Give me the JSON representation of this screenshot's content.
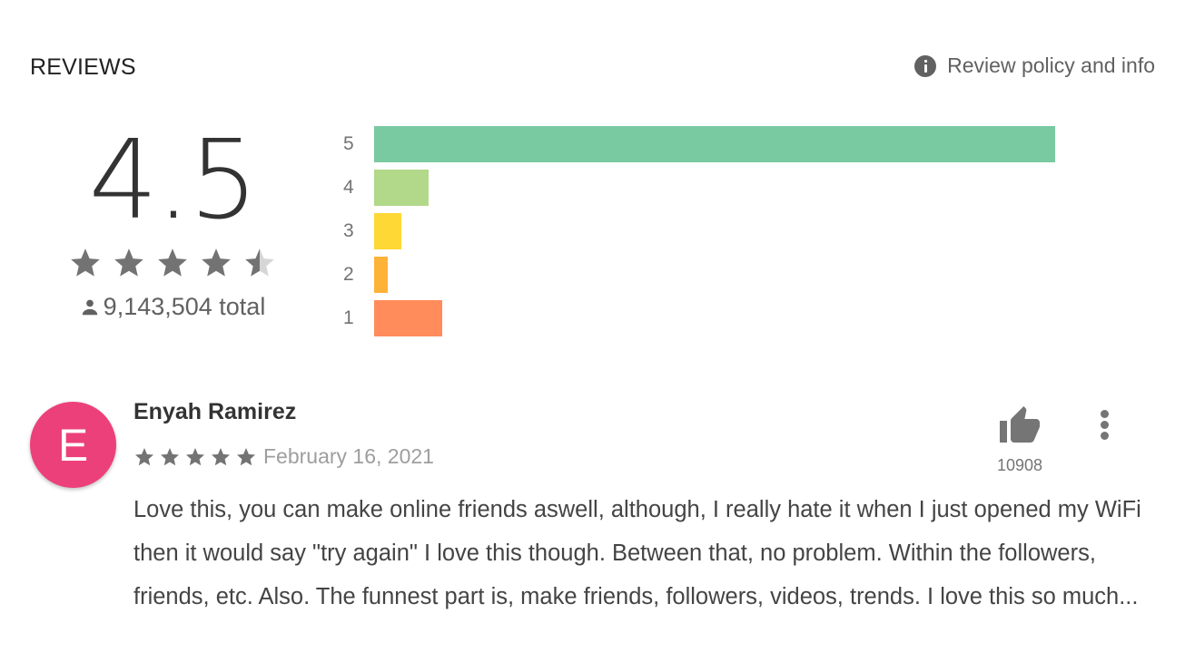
{
  "header": {
    "title": "REVIEWS",
    "policy_link": "Review policy and info",
    "policy_icon": "info-icon"
  },
  "summary": {
    "average_rating": "4.5",
    "stars_filled": 4.5,
    "stars_max": 5,
    "total_icon": "person-icon",
    "total_label": "9,143,504 total"
  },
  "histogram": {
    "rows": [
      {
        "label": "5",
        "value": 1.0,
        "color": "#79c9a1"
      },
      {
        "label": "4",
        "value": 0.08,
        "color": "#b2d88a"
      },
      {
        "label": "3",
        "value": 0.04,
        "color": "#fed834"
      },
      {
        "label": "2",
        "value": 0.02,
        "color": "#ffb238"
      },
      {
        "label": "1",
        "value": 0.1,
        "color": "#ff8c5a"
      }
    ]
  },
  "review": {
    "avatar_letter": "E",
    "avatar_color": "#ec407a",
    "author": "Enyah Ramirez",
    "rating": 5,
    "date": "February 16, 2021",
    "like_icon": "thumbs-up-icon",
    "likes": "10908",
    "more_icon": "more-vert-icon",
    "text": "Love this, you can make online friends aswell, although, I really hate it when I just opened my WiFi then it would say \"try again\" I love this though. Between that, no problem. Within the fol­lowers, friends, etc. Also. The funnest part is, make friends, followers, videos, trends. I love this so much..."
  }
}
